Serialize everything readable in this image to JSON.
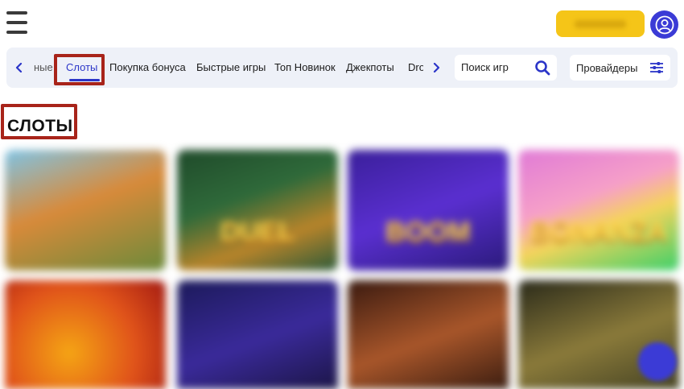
{
  "header": {
    "menu_icon": "hamburger-menu-icon",
    "deposit_button_label": "",
    "avatar_icon": "user-avatar-icon"
  },
  "nav": {
    "left_arrow_icon": "chevron-left-icon",
    "right_arrow_icon": "chevron-right-icon",
    "tabs": [
      {
        "label": "ные",
        "state": "clipped"
      },
      {
        "label": "Слоты",
        "state": "active"
      },
      {
        "label": "Покупка бонуса"
      },
      {
        "label": "Быстрые игры"
      },
      {
        "label": "Топ Новинок"
      },
      {
        "label": "Джекпоты"
      },
      {
        "label": "Drops",
        "state": "clipped"
      }
    ]
  },
  "search": {
    "placeholder": "Поиск игр",
    "icon": "search-icon"
  },
  "providers": {
    "label": "Провайдеры",
    "icon": "filter-sliders-icon"
  },
  "section": {
    "title": "СЛОТЫ"
  },
  "games": {
    "count_visible": 8,
    "captions": [
      "",
      "DUEL",
      "BOOM",
      "BONANZA",
      "",
      "",
      "",
      ""
    ]
  },
  "colors": {
    "accent": "#2b35c8",
    "deposit": "#f5c518",
    "highlight": "#a8241a",
    "nav_bg": "#eef1f8"
  }
}
